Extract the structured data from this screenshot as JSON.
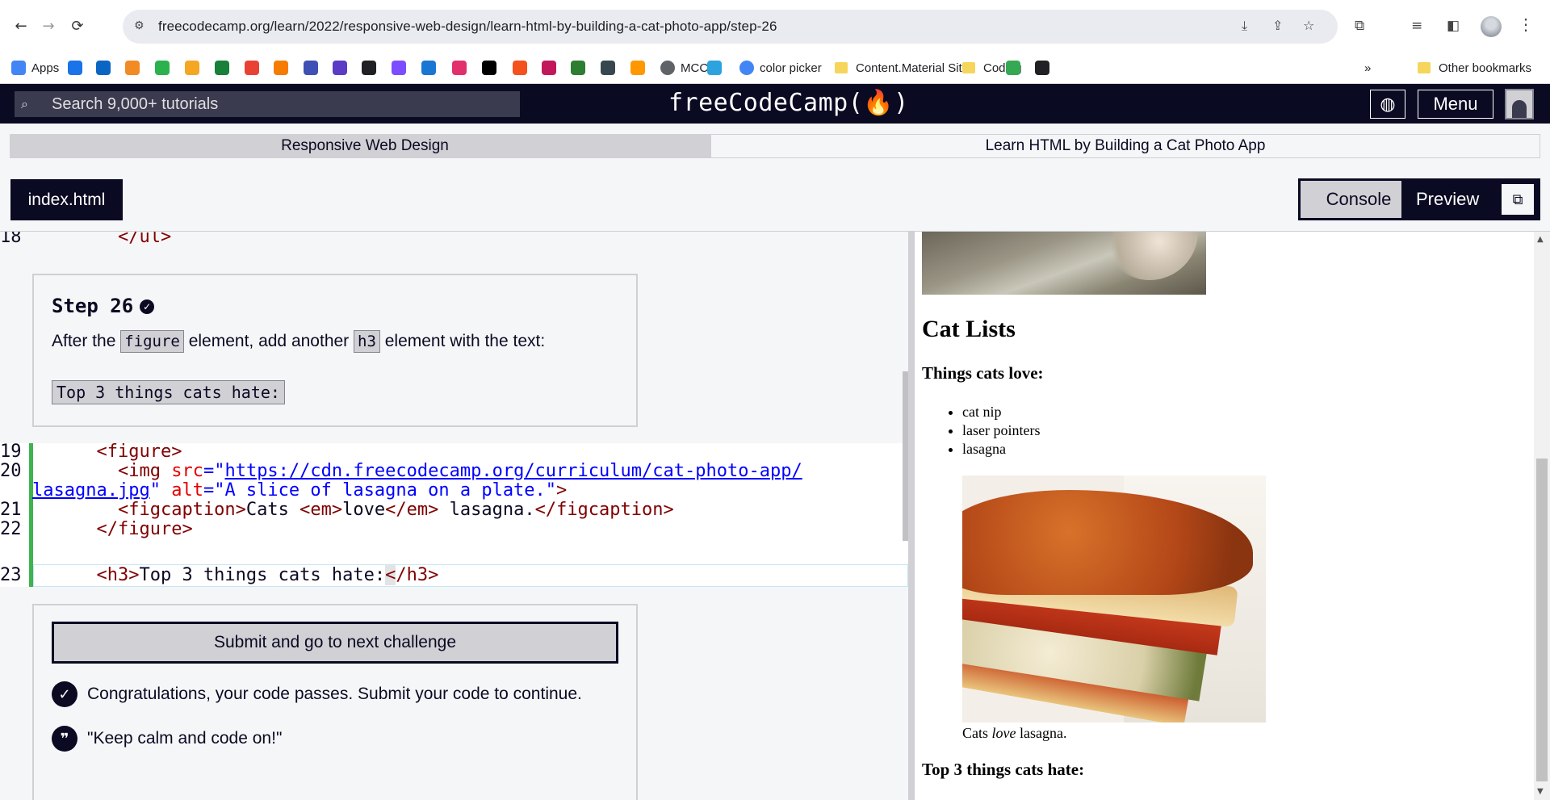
{
  "browser": {
    "url": "freecodecamp.org/learn/2022/responsive-web-design/learn-html-by-building-a-cat-photo-app/step-26",
    "bookmarks": [
      {
        "label": "Apps",
        "icon": "apps-grid-icon",
        "color": "#4285f4"
      },
      {
        "label": "",
        "icon": "bookmark-icon-1",
        "color": "#1a73e8"
      },
      {
        "label": "",
        "icon": "linkedin-icon",
        "color": "#0a66c2"
      },
      {
        "label": "",
        "icon": "bookmark-icon-3",
        "color": "#f28b24"
      },
      {
        "label": "",
        "icon": "bookmark-icon-4",
        "color": "#2bb24c"
      },
      {
        "label": "",
        "icon": "bookmark-icon-5",
        "color": "#f5a623"
      },
      {
        "label": "",
        "icon": "bookmark-icon-6",
        "color": "#188038"
      },
      {
        "label": "",
        "icon": "bookmark-icon-7",
        "color": "#e94235"
      },
      {
        "label": "",
        "icon": "bookmark-icon-8",
        "color": "#f57c00"
      },
      {
        "label": "",
        "icon": "bookmark-icon-9",
        "color": "#3f51b5"
      },
      {
        "label": "",
        "icon": "bookmark-icon-10",
        "color": "#5b3cc4"
      },
      {
        "label": "",
        "icon": "bookmark-icon-11",
        "color": "#202124"
      },
      {
        "label": "",
        "icon": "bookmark-icon-12",
        "color": "#7c4dff"
      },
      {
        "label": "",
        "icon": "bookmark-icon-13",
        "color": "#1976d2"
      },
      {
        "label": "",
        "icon": "instagram-icon",
        "color": "#e1306c"
      },
      {
        "label": "",
        "icon": "tiktok-icon",
        "color": "#000000"
      },
      {
        "label": "",
        "icon": "bookmark-icon-16",
        "color": "#f4511e"
      },
      {
        "label": "",
        "icon": "bookmark-icon-17",
        "color": "#c2185b"
      },
      {
        "label": "",
        "icon": "bookmark-icon-18",
        "color": "#2e7d32"
      },
      {
        "label": "",
        "icon": "bookmark-icon-19",
        "color": "#37474f"
      },
      {
        "label": "",
        "icon": "bookmark-icon-20",
        "color": "#ff9800"
      },
      {
        "label": "MCC",
        "icon": "globe-bookmark-icon",
        "color": "#5f6368"
      },
      {
        "label": "",
        "icon": "telegram-icon",
        "color": "#2aa3df"
      },
      {
        "label": "color picker",
        "icon": "google-icon",
        "color": "#4285f4"
      },
      {
        "label": "Content.Material Site",
        "icon": "folder-icon",
        "color": "#f5d55b"
      },
      {
        "label": "Coding",
        "icon": "folder-icon",
        "color": "#f5d55b"
      },
      {
        "label": "",
        "icon": "bookmark-icon-10b",
        "color": "#34a853"
      },
      {
        "label": "",
        "icon": "github-icon",
        "color": "#202124"
      }
    ],
    "overflow_label": "»",
    "other_bookmarks": "Other bookmarks"
  },
  "fcc_nav": {
    "search_placeholder": "Search 9,000+ tutorials",
    "logo": "freeCodeCamp(🔥)",
    "menu_label": "Menu"
  },
  "breadcrumb": {
    "superblock": "Responsive Web Design",
    "block": "Learn HTML by Building a Cat Photo App"
  },
  "tabs": {
    "file": "index.html",
    "console": "Console",
    "preview": "Preview"
  },
  "editor": {
    "line18_num": "18",
    "line18_code": "        </ul>",
    "step": {
      "title": "Step 26",
      "desc_before": "After the ",
      "desc_code1": "figure",
      "desc_mid": " element, add another ",
      "desc_code2": "h3",
      "desc_after": " element with the text:",
      "code_text": "Top 3 things cats hate:"
    },
    "lines": {
      "l19": "19",
      "l20": "20",
      "l21": "21",
      "l22": "22",
      "l23": "23",
      "figure_open": "<figure>",
      "img_tag_open": "<img ",
      "src_attr": "src",
      "eq_q": "=\"",
      "src_url_a": "https://cdn.freecodecamp.org/curriculum/cat-photo-app/",
      "src_url_b": "lasagna.jpg",
      "q": "\" ",
      "alt_attr": "alt",
      "alt_value": "=\"A slice of lasagna on a plate.\"",
      "img_close": ">",
      "figcaption_open": "<figcaption>",
      "cats_text": "Cats ",
      "em_open": "<em>",
      "love_text": "love",
      "em_close": "</em>",
      "lasagna_text": " lasagna.",
      "figcaption_close": "</figcaption>",
      "figure_close": "</figure>",
      "h3_open": "<h3>",
      "h3_text": "Top 3 things cats hate:",
      "h3_close_lt": "<",
      "h3_close_rest": "/h3>"
    },
    "submit_label": "Submit and go to next challenge",
    "pass_message": "Congratulations, your code passes. Submit your code to continue.",
    "quote": "\"Keep calm and code on!\""
  },
  "preview": {
    "h2": "Cat Lists",
    "h3_love": "Things cats love:",
    "list": [
      "cat nip",
      "laser pointers",
      "lasagna"
    ],
    "caption_before": "Cats ",
    "caption_em": "love",
    "caption_after": " lasagna.",
    "h3_hate": "Top 3 things cats hate:"
  }
}
